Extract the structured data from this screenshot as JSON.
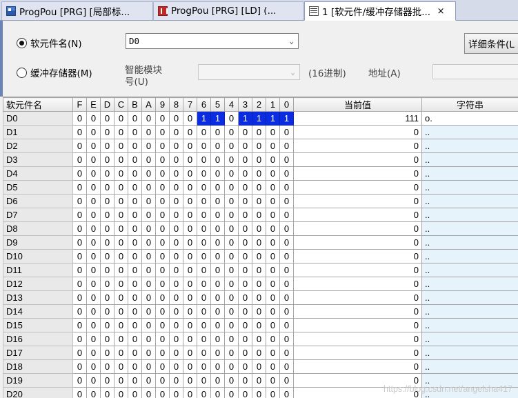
{
  "tabs": [
    {
      "label": "ProgPou [PRG] [局部标...",
      "icon": "program-icon",
      "active": false
    },
    {
      "label": "ProgPou [PRG] [LD] (...",
      "icon": "ladder-icon",
      "active": false
    },
    {
      "label": "1 [软元件/缓冲存储器批...",
      "icon": "monitor-icon",
      "active": true,
      "close": "×"
    }
  ],
  "controls": {
    "device_radio_label": "软元件名(N)",
    "device_value": "D0",
    "buffer_radio_label": "缓冲存储器(M)",
    "module_label_line1": "智能模块",
    "module_label_line2": "号(U)",
    "hex_label": "(16进制)",
    "address_label": "地址(A)",
    "detail_button": "详细条件(L"
  },
  "table": {
    "name_header": "软元件名",
    "bit_headers": [
      "F",
      "E",
      "D",
      "C",
      "B",
      "A",
      "9",
      "8",
      "7",
      "6",
      "5",
      "4",
      "3",
      "2",
      "1",
      "0"
    ],
    "value_header": "当前值",
    "string_header": "字符串",
    "rows": [
      {
        "name": "D0",
        "bits": [
          "0",
          "0",
          "0",
          "0",
          "0",
          "0",
          "0",
          "0",
          "0",
          "1",
          "1",
          "0",
          "1",
          "1",
          "1",
          "1"
        ],
        "value": "111",
        "string": "o."
      },
      {
        "name": "D1",
        "bits": [
          "0",
          "0",
          "0",
          "0",
          "0",
          "0",
          "0",
          "0",
          "0",
          "0",
          "0",
          "0",
          "0",
          "0",
          "0",
          "0"
        ],
        "value": "0",
        "string": ".."
      },
      {
        "name": "D2",
        "bits": [
          "0",
          "0",
          "0",
          "0",
          "0",
          "0",
          "0",
          "0",
          "0",
          "0",
          "0",
          "0",
          "0",
          "0",
          "0",
          "0"
        ],
        "value": "0",
        "string": ".."
      },
      {
        "name": "D3",
        "bits": [
          "0",
          "0",
          "0",
          "0",
          "0",
          "0",
          "0",
          "0",
          "0",
          "0",
          "0",
          "0",
          "0",
          "0",
          "0",
          "0"
        ],
        "value": "0",
        "string": ".."
      },
      {
        "name": "D4",
        "bits": [
          "0",
          "0",
          "0",
          "0",
          "0",
          "0",
          "0",
          "0",
          "0",
          "0",
          "0",
          "0",
          "0",
          "0",
          "0",
          "0"
        ],
        "value": "0",
        "string": ".."
      },
      {
        "name": "D5",
        "bits": [
          "0",
          "0",
          "0",
          "0",
          "0",
          "0",
          "0",
          "0",
          "0",
          "0",
          "0",
          "0",
          "0",
          "0",
          "0",
          "0"
        ],
        "value": "0",
        "string": ".."
      },
      {
        "name": "D6",
        "bits": [
          "0",
          "0",
          "0",
          "0",
          "0",
          "0",
          "0",
          "0",
          "0",
          "0",
          "0",
          "0",
          "0",
          "0",
          "0",
          "0"
        ],
        "value": "0",
        "string": ".."
      },
      {
        "name": "D7",
        "bits": [
          "0",
          "0",
          "0",
          "0",
          "0",
          "0",
          "0",
          "0",
          "0",
          "0",
          "0",
          "0",
          "0",
          "0",
          "0",
          "0"
        ],
        "value": "0",
        "string": ".."
      },
      {
        "name": "D8",
        "bits": [
          "0",
          "0",
          "0",
          "0",
          "0",
          "0",
          "0",
          "0",
          "0",
          "0",
          "0",
          "0",
          "0",
          "0",
          "0",
          "0"
        ],
        "value": "0",
        "string": ".."
      },
      {
        "name": "D9",
        "bits": [
          "0",
          "0",
          "0",
          "0",
          "0",
          "0",
          "0",
          "0",
          "0",
          "0",
          "0",
          "0",
          "0",
          "0",
          "0",
          "0"
        ],
        "value": "0",
        "string": ".."
      },
      {
        "name": "D10",
        "bits": [
          "0",
          "0",
          "0",
          "0",
          "0",
          "0",
          "0",
          "0",
          "0",
          "0",
          "0",
          "0",
          "0",
          "0",
          "0",
          "0"
        ],
        "value": "0",
        "string": ".."
      },
      {
        "name": "D11",
        "bits": [
          "0",
          "0",
          "0",
          "0",
          "0",
          "0",
          "0",
          "0",
          "0",
          "0",
          "0",
          "0",
          "0",
          "0",
          "0",
          "0"
        ],
        "value": "0",
        "string": ".."
      },
      {
        "name": "D12",
        "bits": [
          "0",
          "0",
          "0",
          "0",
          "0",
          "0",
          "0",
          "0",
          "0",
          "0",
          "0",
          "0",
          "0",
          "0",
          "0",
          "0"
        ],
        "value": "0",
        "string": ".."
      },
      {
        "name": "D13",
        "bits": [
          "0",
          "0",
          "0",
          "0",
          "0",
          "0",
          "0",
          "0",
          "0",
          "0",
          "0",
          "0",
          "0",
          "0",
          "0",
          "0"
        ],
        "value": "0",
        "string": ".."
      },
      {
        "name": "D14",
        "bits": [
          "0",
          "0",
          "0",
          "0",
          "0",
          "0",
          "0",
          "0",
          "0",
          "0",
          "0",
          "0",
          "0",
          "0",
          "0",
          "0"
        ],
        "value": "0",
        "string": ".."
      },
      {
        "name": "D15",
        "bits": [
          "0",
          "0",
          "0",
          "0",
          "0",
          "0",
          "0",
          "0",
          "0",
          "0",
          "0",
          "0",
          "0",
          "0",
          "0",
          "0"
        ],
        "value": "0",
        "string": ".."
      },
      {
        "name": "D16",
        "bits": [
          "0",
          "0",
          "0",
          "0",
          "0",
          "0",
          "0",
          "0",
          "0",
          "0",
          "0",
          "0",
          "0",
          "0",
          "0",
          "0"
        ],
        "value": "0",
        "string": ".."
      },
      {
        "name": "D17",
        "bits": [
          "0",
          "0",
          "0",
          "0",
          "0",
          "0",
          "0",
          "0",
          "0",
          "0",
          "0",
          "0",
          "0",
          "0",
          "0",
          "0"
        ],
        "value": "0",
        "string": ".."
      },
      {
        "name": "D18",
        "bits": [
          "0",
          "0",
          "0",
          "0",
          "0",
          "0",
          "0",
          "0",
          "0",
          "0",
          "0",
          "0",
          "0",
          "0",
          "0",
          "0"
        ],
        "value": "0",
        "string": ".."
      },
      {
        "name": "D19",
        "bits": [
          "0",
          "0",
          "0",
          "0",
          "0",
          "0",
          "0",
          "0",
          "0",
          "0",
          "0",
          "0",
          "0",
          "0",
          "0",
          "0"
        ],
        "value": "0",
        "string": ".."
      },
      {
        "name": "D20",
        "bits": [
          "0",
          "0",
          "0",
          "0",
          "0",
          "0",
          "0",
          "0",
          "0",
          "0",
          "0",
          "0",
          "0",
          "0",
          "0",
          "0"
        ],
        "value": "0",
        "string": ".."
      }
    ]
  },
  "watermark": "https://blog.csdn.net/angelsha417"
}
